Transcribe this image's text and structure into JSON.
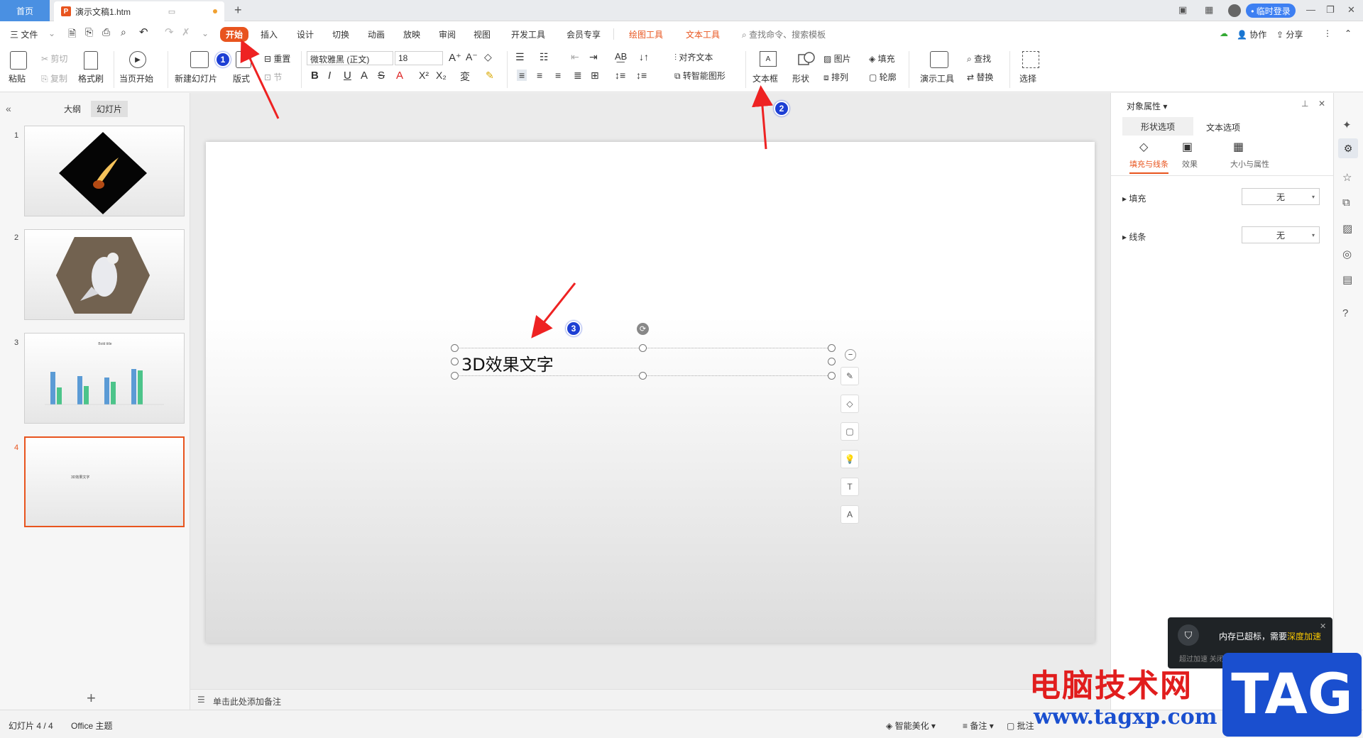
{
  "titlebar": {
    "home_tab": "首页",
    "doc_tab": "演示文稿1.htm",
    "login_button": "• 临时登录"
  },
  "menubar": {
    "file": "三 文件",
    "tabs": [
      "开始",
      "插入",
      "设计",
      "切换",
      "动画",
      "放映",
      "审阅",
      "视图",
      "开发工具",
      "会员专享"
    ],
    "context_tabs": [
      "绘图工具",
      "文本工具"
    ],
    "search_placeholder": "查找命令、搜索模板",
    "right_actions": [
      "协作",
      "分享"
    ]
  },
  "ribbon": {
    "paste": "粘贴",
    "cut": "剪切",
    "copy": "复制",
    "format_painter": "格式刷",
    "play_from_current": "当页开始",
    "new_slide": "新建幻灯片",
    "layout": "版式",
    "reset": "重置",
    "section": "节",
    "font_name": "微软雅黑 (正文)",
    "font_size": "18",
    "align_text": "对齐文本",
    "smart_art": "转智能图形",
    "textbox": "文本框",
    "shape": "形状",
    "picture": "图片",
    "fill": "填充",
    "arrange": "排列",
    "outline": "轮廓",
    "presentation_tools": "演示工具",
    "find": "查找",
    "replace": "替换",
    "select": "选择"
  },
  "leftpanel": {
    "tabs": [
      "大纲",
      "幻灯片"
    ],
    "slide_numbers": [
      "1",
      "2",
      "3",
      "4"
    ],
    "slide3_title": "Bold title",
    "slide4_text": "3D效果文字"
  },
  "slide": {
    "textbox_text": "3D效果文字"
  },
  "annotations": {
    "step1": "1",
    "step2": "2",
    "step3": "3"
  },
  "notes": {
    "placeholder": "单击此处添加备注"
  },
  "rightpanel": {
    "title": "对象属性",
    "tabs": [
      "形状选项",
      "文本选项"
    ],
    "subtabs": [
      "填充与线条",
      "效果",
      "大小与属性"
    ],
    "fill_label": "填充",
    "fill_value": "无",
    "line_label": "线条",
    "line_value": "无"
  },
  "statusbar": {
    "slide_info": "幻灯片 4 / 4",
    "theme": "Office 主题",
    "smart_beautify": "智能美化",
    "notes_btn": "备注",
    "comments_btn": "批注"
  },
  "popup": {
    "message": "内存已超标，需要",
    "action": "深度加速",
    "sub": "超过加速 关闭"
  },
  "watermark": {
    "cn": "电脑技术网",
    "url": "www.tagxp.com",
    "tag": "TAG"
  },
  "colors": {
    "accent": "#e8541e",
    "login_blue": "#3d7ff2",
    "chart_blue": "#5b9bd5",
    "chart_green": "#4cc48a"
  }
}
